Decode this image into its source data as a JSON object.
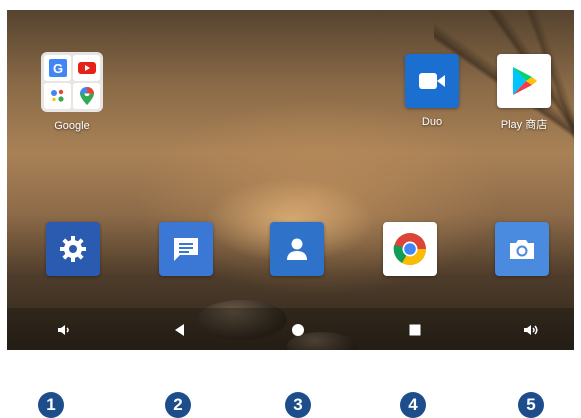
{
  "home_apps_top": {
    "folder_label": "Google",
    "duo_label": "Duo",
    "play_label": "Play 商店"
  },
  "dock": {
    "items": [
      {
        "icon": "settings-icon",
        "color": "#2b5bb0"
      },
      {
        "icon": "messages-icon",
        "color": "#3b78d6"
      },
      {
        "icon": "contacts-icon",
        "color": "#2e72c9"
      },
      {
        "icon": "chrome-icon",
        "color": "#ffffff"
      },
      {
        "icon": "camera-icon",
        "color": "#4a8be0"
      }
    ]
  },
  "navbar": {
    "buttons": [
      "volume-down-icon",
      "back-icon",
      "home-icon",
      "recents-icon",
      "volume-up-icon"
    ]
  },
  "callouts": [
    "1",
    "2",
    "3",
    "4",
    "5"
  ],
  "colors": {
    "callout": "#1e4d8c",
    "duo": "#1a6fd1"
  }
}
